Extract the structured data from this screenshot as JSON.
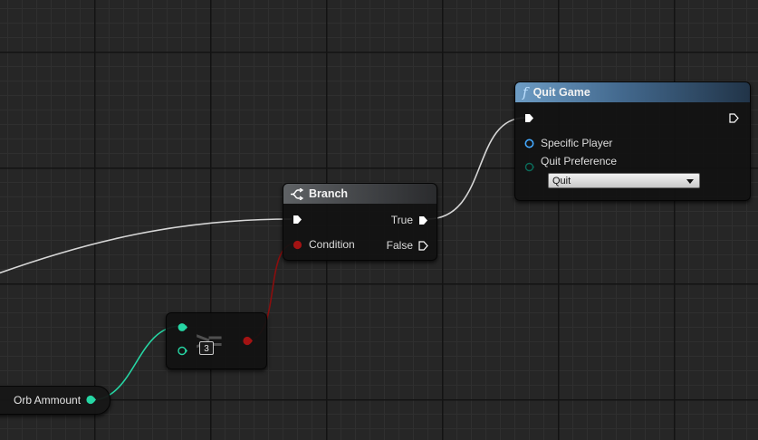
{
  "colors": {
    "exec": "#ffffff",
    "wire_exec": "#d0d0d0",
    "wire_int": "#26d6a4",
    "wire_bool": "#8a0e0e",
    "pin_int": "#26d6a4",
    "pin_bool": "#a31313",
    "pin_object": "#44a9ff"
  },
  "icons": {
    "branch": "branch-arrows-icon",
    "function": "function-f-icon"
  },
  "quit_game": {
    "title": "Quit Game",
    "specific_player_label": "Specific Player",
    "quit_preference_label": "Quit Preference",
    "quit_preference_value": "Quit"
  },
  "branch": {
    "title": "Branch",
    "true_label": "True",
    "false_label": "False",
    "condition_label": "Condition"
  },
  "compare": {
    "operator": ">=",
    "constant_value": "3"
  },
  "variable": {
    "name": "Orb Ammount"
  }
}
